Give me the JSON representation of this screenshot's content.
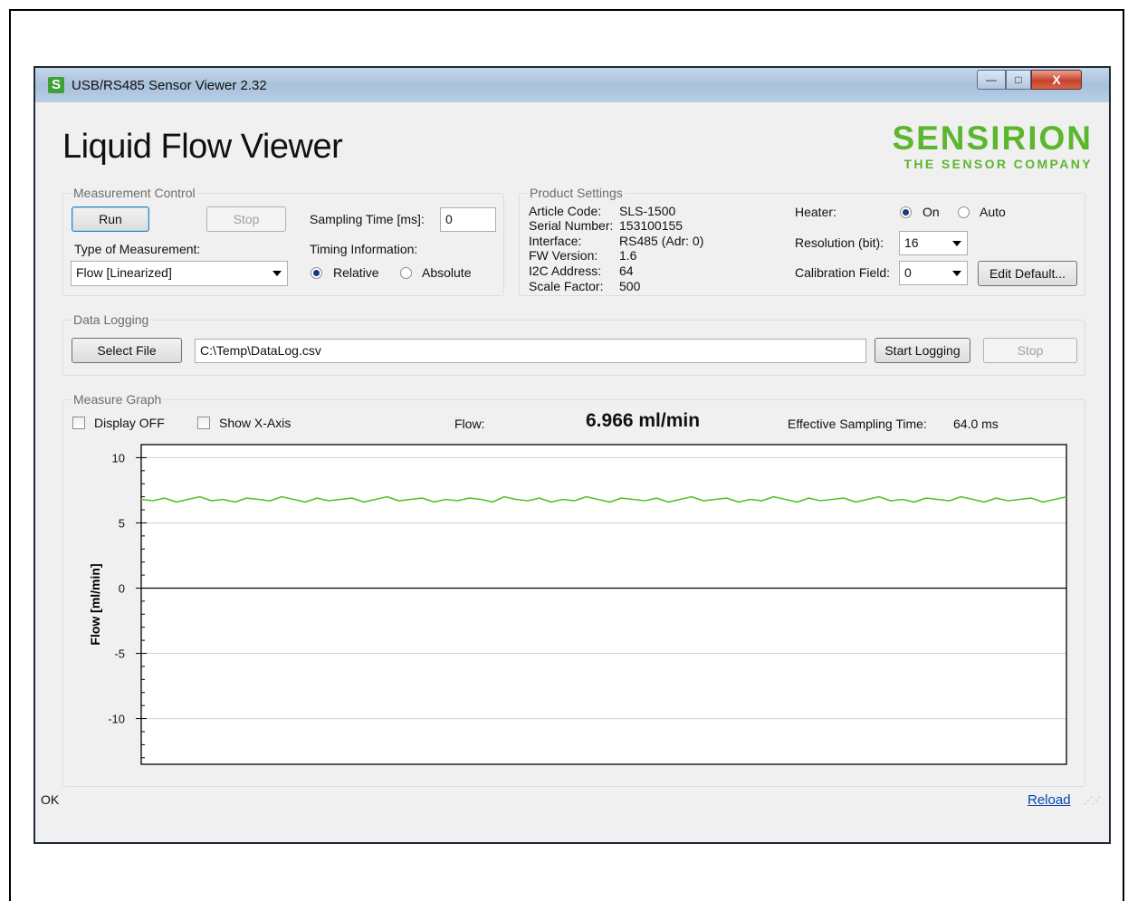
{
  "window": {
    "title": "USB/RS485 Sensor Viewer 2.32",
    "icon_letter": "S",
    "minimize_icon": "minimize-icon",
    "maximize_icon": "maximize-icon",
    "close_icon": "close-icon",
    "close_glyph": "X"
  },
  "header": {
    "title": "Liquid Flow Viewer",
    "brand_name": "SENSIRION",
    "brand_tagline": "THE SENSOR COMPANY",
    "brand_color": "#5cb62e"
  },
  "measurement_control": {
    "group_label": "Measurement Control",
    "run_label": "Run",
    "stop_label": "Stop",
    "sampling_label": "Sampling Time [ms]:",
    "sampling_value": "0",
    "type_label": "Type of Measurement:",
    "type_value": "Flow [Linearized]",
    "timing_label": "Timing Information:",
    "relative_label": "Relative",
    "absolute_label": "Absolute",
    "timing_selected": "Relative"
  },
  "product_settings": {
    "group_label": "Product Settings",
    "rows": [
      {
        "label": "Article Code:",
        "value": "SLS-1500"
      },
      {
        "label": "Serial Number:",
        "value": "153100155"
      },
      {
        "label": "Interface:",
        "value": "RS485 (Adr: 0)"
      },
      {
        "label": "FW Version:",
        "value": "1.6"
      },
      {
        "label": "I2C Address:",
        "value": "64"
      },
      {
        "label": "Scale Factor:",
        "value": "500"
      }
    ],
    "heater_label": "Heater:",
    "heater_on": "On",
    "heater_auto": "Auto",
    "heater_selected": "On",
    "resolution_label": "Resolution (bit):",
    "resolution_value": "16",
    "calibration_label": "Calibration Field:",
    "calibration_value": "0",
    "edit_default_label": "Edit Default..."
  },
  "data_logging": {
    "group_label": "Data Logging",
    "select_file_label": "Select File",
    "file_path": "C:\\Temp\\DataLog.csv",
    "start_logging_label": "Start Logging",
    "stop_label": "Stop"
  },
  "measure_graph": {
    "group_label": "Measure Graph",
    "display_off_label": "Display OFF",
    "show_x_axis_label": "Show X-Axis",
    "flow_label": "Flow:",
    "flow_value": "6.966 ml/min",
    "effective_label": "Effective Sampling Time:",
    "effective_value": "64.0 ms"
  },
  "status": {
    "text": "OK",
    "reload_label": "Reload"
  },
  "chart_data": {
    "type": "line",
    "ylabel": "Flow [ml/min]",
    "ylim": [
      -13.5,
      11
    ],
    "yticks": [
      10,
      5,
      0,
      -5,
      -10
    ],
    "grid": true,
    "series": [
      {
        "color": "#55c32a",
        "y": [
          6.8,
          6.7,
          6.9,
          6.6,
          6.8,
          7.0,
          6.7,
          6.8,
          6.6,
          6.9,
          6.8,
          6.7,
          7.0,
          6.8,
          6.6,
          6.9,
          6.7,
          6.8,
          6.9,
          6.6,
          6.8,
          7.0,
          6.7,
          6.8,
          6.9,
          6.6,
          6.8,
          6.7,
          6.9,
          6.8,
          6.6,
          7.0,
          6.8,
          6.7,
          6.9,
          6.6,
          6.8,
          6.7,
          7.0,
          6.8,
          6.6,
          6.9,
          6.8,
          6.7,
          6.9,
          6.6,
          6.8,
          7.0,
          6.7,
          6.8,
          6.9,
          6.6,
          6.8,
          6.7,
          7.0,
          6.8,
          6.6,
          6.9,
          6.7,
          6.8,
          6.9,
          6.6,
          6.8,
          7.0,
          6.7,
          6.8,
          6.6,
          6.9,
          6.8,
          6.7,
          7.0,
          6.8,
          6.6,
          6.9,
          6.7,
          6.8,
          6.9,
          6.6,
          6.8,
          7.0
        ]
      }
    ]
  }
}
